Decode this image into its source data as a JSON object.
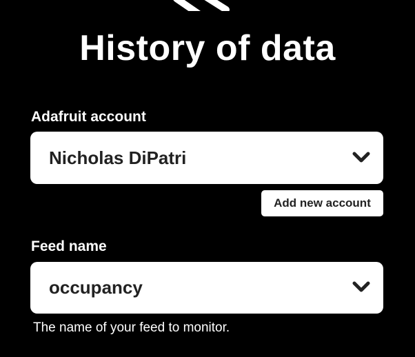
{
  "page": {
    "title": "History of data"
  },
  "account_field": {
    "label": "Adafruit account",
    "selected": "Nicholas DiPatri",
    "add_button_label": "Add new account"
  },
  "feed_field": {
    "label": "Feed name",
    "selected": "occupancy",
    "helper": "The name of your feed to monitor."
  },
  "icons": {
    "top": "service-logo-icon",
    "dropdown": "chevron-down-icon"
  },
  "colors": {
    "background": "#000000",
    "field_bg": "#ffffff",
    "text_dark": "#222222",
    "text_light": "#ffffff"
  }
}
